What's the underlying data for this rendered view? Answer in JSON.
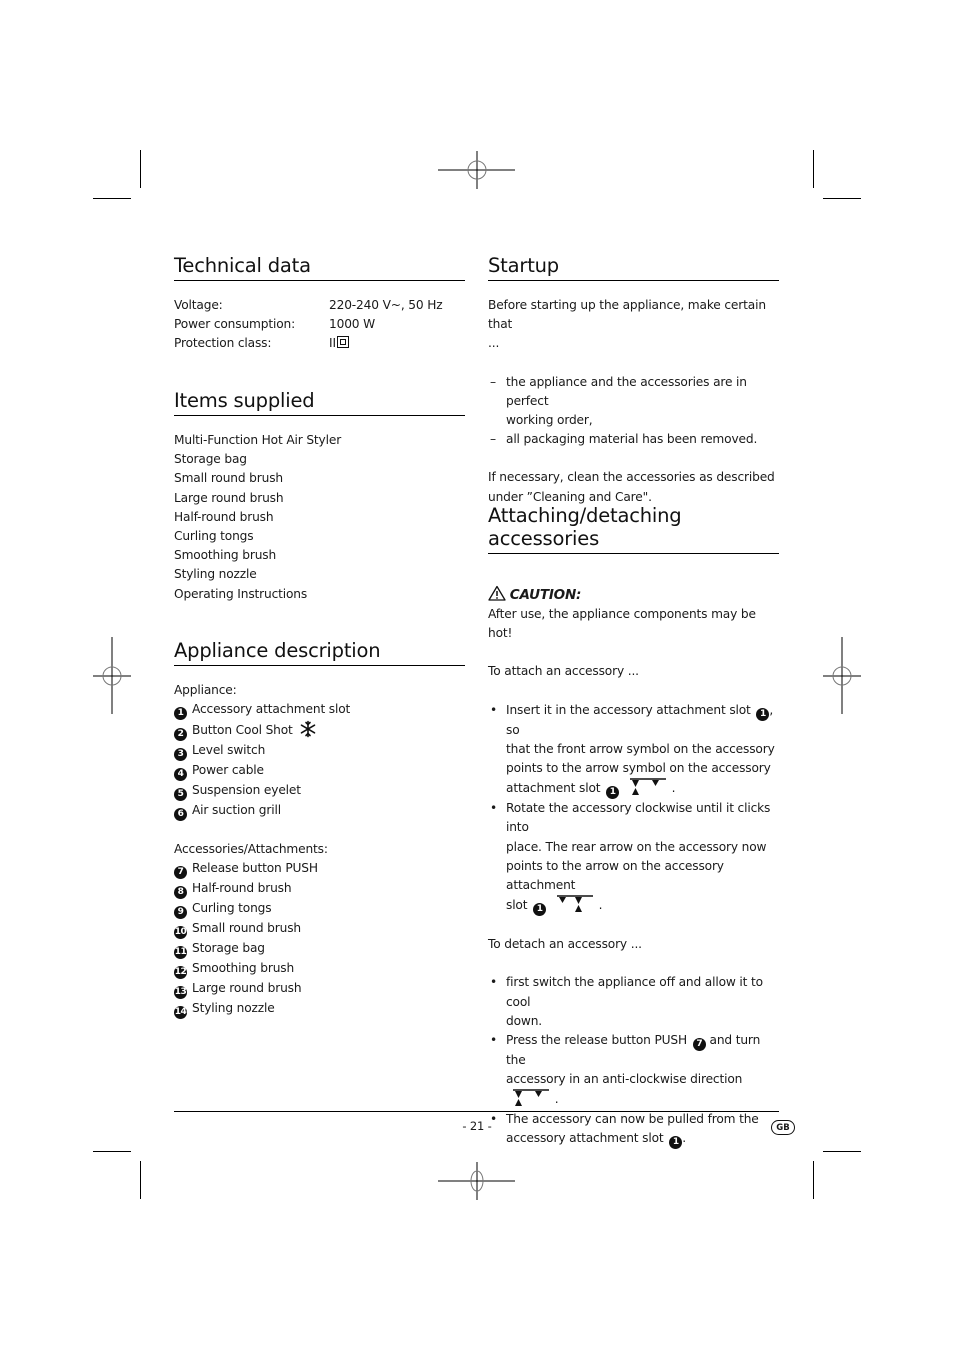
{
  "technical_data": {
    "title": "Technical data",
    "rows": [
      {
        "label": "Voltage:",
        "value": "220-240 V~, 50 Hz"
      },
      {
        "label": "Power consumption:",
        "value": "1000 W"
      },
      {
        "label": "Protection class:",
        "value": "II"
      }
    ],
    "protection_icon": "protection-class-ii-icon"
  },
  "items_supplied": {
    "title": "Items supplied",
    "items": [
      "Multi-Function Hot Air Styler",
      "Storage bag",
      "Small round brush",
      "Large round brush",
      "Half-round brush",
      "Curling tongs",
      "Smoothing brush",
      "Styling nozzle",
      "Operating Instructions"
    ]
  },
  "appliance_description": {
    "title": "Appliance description",
    "appliance_heading": "Appliance:",
    "appliance_items": [
      {
        "num": "1",
        "label": "Accessory attachment slot"
      },
      {
        "num": "2",
        "label": "Button Cool Shot",
        "icon": "snowflake-icon"
      },
      {
        "num": "3",
        "label": "Level switch"
      },
      {
        "num": "4",
        "label": "Power cable"
      },
      {
        "num": "5",
        "label": "Suspension eyelet"
      },
      {
        "num": "6",
        "label": "Air suction grill"
      }
    ],
    "accessories_heading": "Accessories/Attachments:",
    "accessory_items": [
      {
        "num": "7",
        "label": "Release button PUSH"
      },
      {
        "num": "8",
        "label": "Half-round brush"
      },
      {
        "num": "9",
        "label": "Curling tongs"
      },
      {
        "num": "10",
        "label": "Small round brush"
      },
      {
        "num": "11",
        "label": "Storage bag"
      },
      {
        "num": "12",
        "label": "Smoothing brush"
      },
      {
        "num": "13",
        "label": "Large round brush"
      },
      {
        "num": "14",
        "label": "Styling nozzle"
      }
    ]
  },
  "startup": {
    "title": "Startup",
    "intro_line1": "Before starting up the appliance, make certain that",
    "intro_line2": "...",
    "dash_items": [
      {
        "line1": "the appliance and the accessories are in perfect",
        "line2": "working order,"
      },
      {
        "line1": "all packaging material  has been removed.",
        "line2": ""
      }
    ],
    "dash": "–",
    "clean_line1": "If necessary, clean the accessories as described",
    "clean_line2": "under ”Cleaning and Care\"."
  },
  "attaching": {
    "title": "Attaching/detaching accessories",
    "caution_icon": "warning-triangle-icon",
    "caution_label": "CAUTION:",
    "caution_text": "After use, the appliance components may be hot!",
    "attach_intro": "To attach an accessory ...",
    "attach_steps": [
      {
        "lines": [
          "Insert it in the accessory attachment slot",
          "that the front arrow symbol on the accessory",
          "points to the arrow symbol on the accessory",
          "attachment slot"
        ],
        "after_num_1": ", so",
        "ref": "1",
        "arrow_icon": "arrows-front-aligned-icon"
      },
      {
        "lines": [
          "Rotate the accessory clockwise until it clicks into",
          "place. The rear arrow on the accessory now",
          "points to the arrow on the accessory attachment",
          "slot"
        ],
        "ref": "1",
        "arrow_icon": "arrows-rear-aligned-icon"
      }
    ],
    "detach_intro": "To detach an accessory ...",
    "detach_steps": [
      {
        "lines": [
          "first switch the appliance off and allow it to cool",
          "down."
        ]
      },
      {
        "lines": [
          "Press the release button PUSH",
          "and turn the",
          "accessory in an anti-clockwise direction"
        ],
        "ref": "7",
        "arrow_icon": "arrows-anticlockwise-icon"
      },
      {
        "lines": [
          "The accessory can now be pulled from the",
          "accessory attachment slot"
        ],
        "ref": "1"
      }
    ],
    "bullet": "•",
    "period": "."
  },
  "footer": {
    "page_number": "- 21 -",
    "language_badge": "GB"
  }
}
